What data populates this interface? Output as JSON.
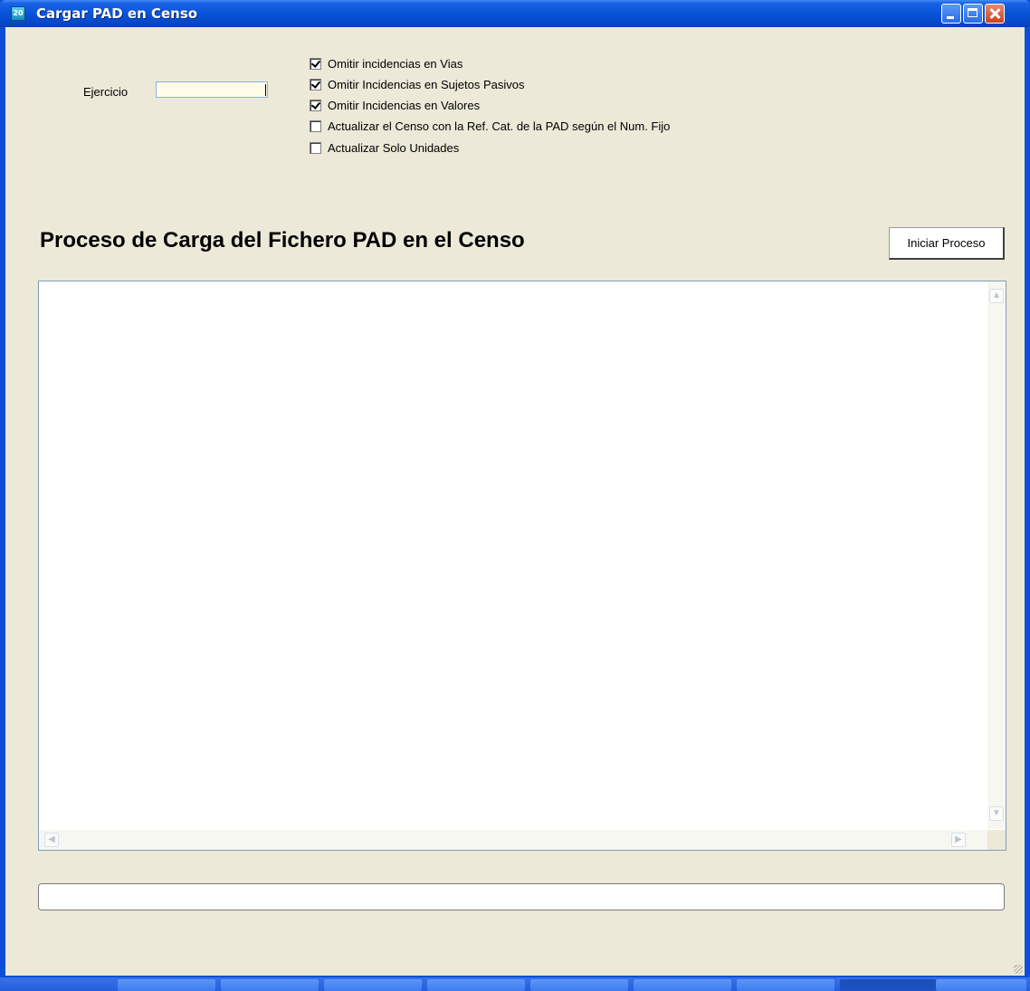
{
  "window": {
    "title": "Cargar PAD en Censo",
    "icon_label": "20"
  },
  "form": {
    "ejercicio_label": "Ejercicio",
    "ejercicio_value": "",
    "options": [
      {
        "label": "Omitir incidencias en Vias",
        "checked": true
      },
      {
        "label": "Omitir Incidencias en Sujetos Pasivos",
        "checked": true
      },
      {
        "label": "Omitir Incidencias en Valores",
        "checked": true
      },
      {
        "label": "Actualizar el Censo con la Ref. Cat. de la PAD según el Num. Fijo",
        "checked": false
      },
      {
        "label": "Actualizar Solo Unidades",
        "checked": false
      }
    ]
  },
  "main": {
    "heading": "Proceso de Carga del Fichero PAD en el Censo",
    "start_button": "Iniciar Proceso",
    "log_text": "",
    "progress": 0
  },
  "icons": {
    "scroll_up": "▲",
    "scroll_down": "▼",
    "scroll_left": "◀",
    "scroll_right": "▶"
  }
}
